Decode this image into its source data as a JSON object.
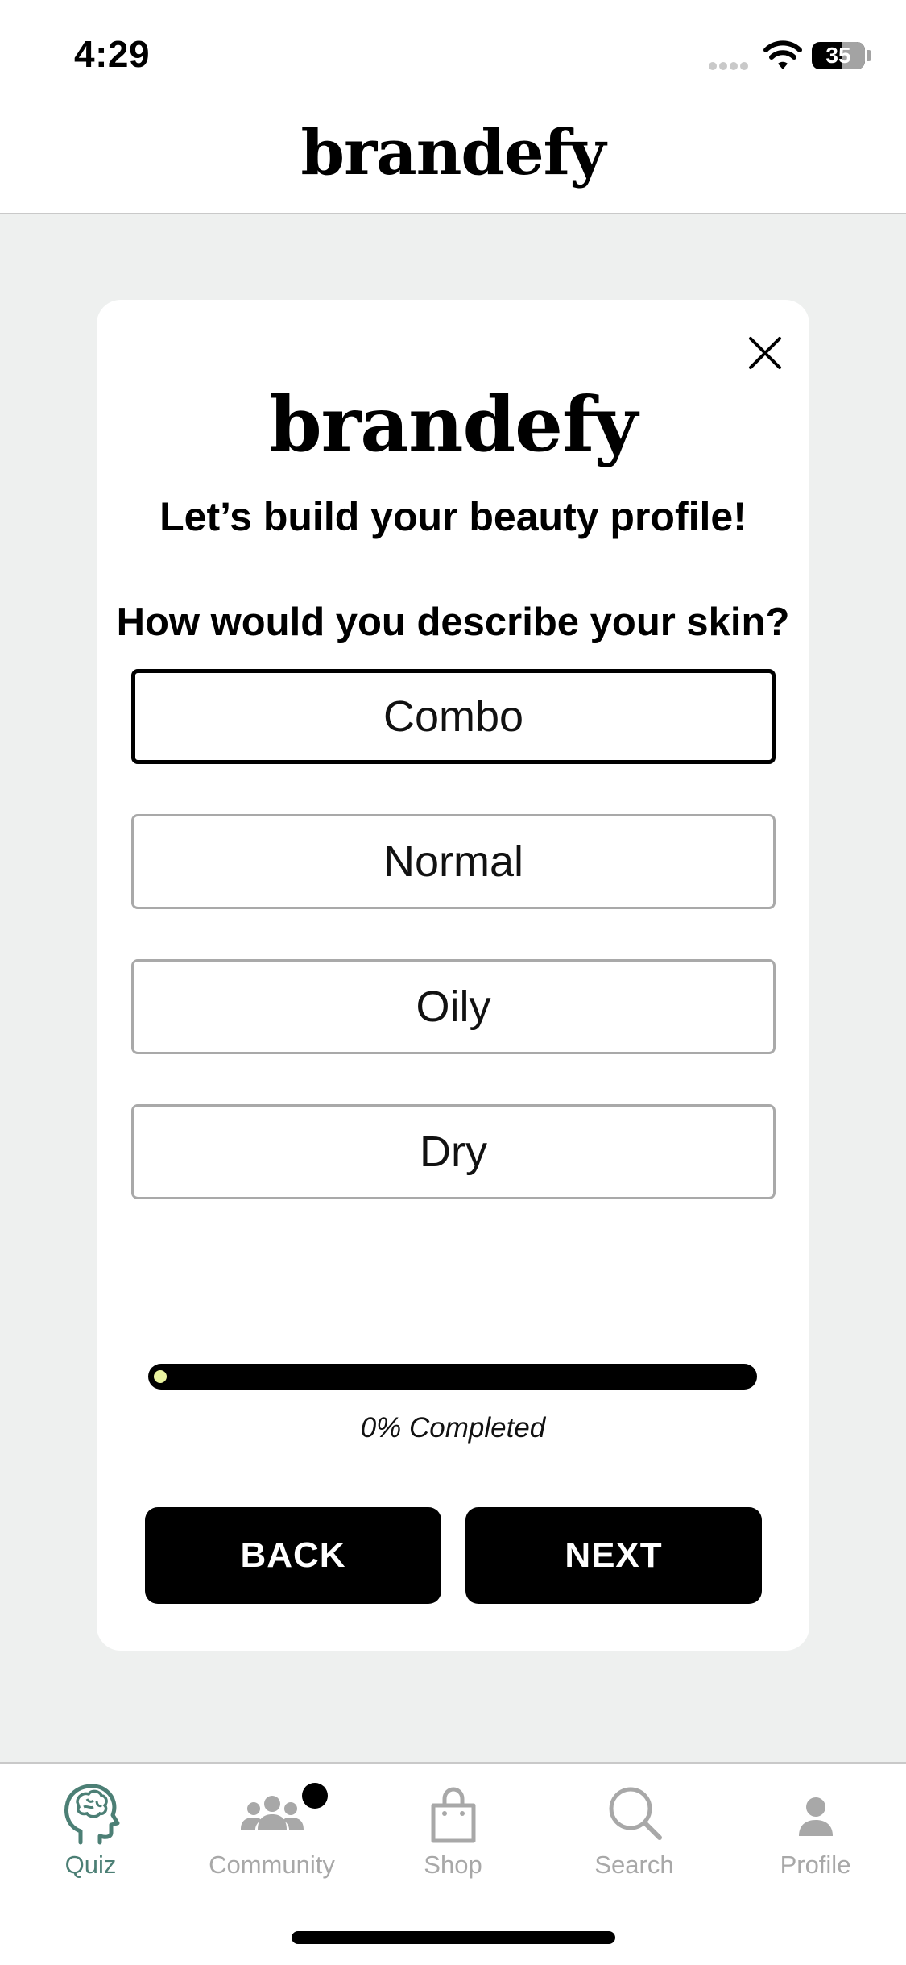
{
  "status_bar": {
    "time": "4:29",
    "battery": "35"
  },
  "header": {
    "logo": "brandefy"
  },
  "modal": {
    "logo": "brandefy",
    "subtitle": "Let’s build your beauty profile!",
    "question": "How would you describe your skin?",
    "options": [
      {
        "label": "Combo",
        "selected": true
      },
      {
        "label": "Normal",
        "selected": false
      },
      {
        "label": "Oily",
        "selected": false
      },
      {
        "label": "Dry",
        "selected": false
      }
    ],
    "progress": {
      "percent": 0,
      "text": "0% Completed",
      "track_color": "#000000",
      "dot_color": "#eaf3a0"
    },
    "back_label": "BACK",
    "next_label": "NEXT"
  },
  "tab_bar": {
    "active_color": "#4c7f75",
    "inactive_color": "#a8a8a8",
    "tabs": [
      {
        "label": "Quiz",
        "icon": "brain-head-icon",
        "active": true
      },
      {
        "label": "Community",
        "icon": "people-icon",
        "active": false,
        "badge": true
      },
      {
        "label": "Shop",
        "icon": "shopping-bag-icon",
        "active": false
      },
      {
        "label": "Search",
        "icon": "search-icon",
        "active": false
      },
      {
        "label": "Profile",
        "icon": "person-icon",
        "active": false
      }
    ]
  }
}
